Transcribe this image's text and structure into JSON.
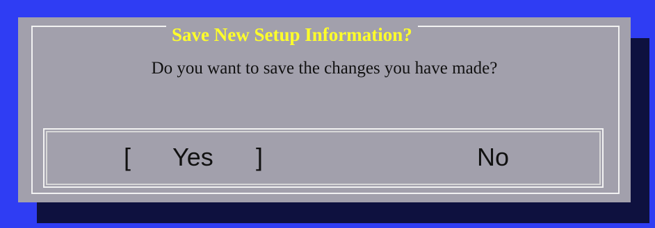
{
  "dialog": {
    "title": "Save New Setup Information?",
    "message": "Do you want to save the changes you have made?"
  },
  "buttons": {
    "yes": {
      "label": "Yes",
      "selected": true,
      "left_bracket": "[",
      "right_bracket": "]"
    },
    "no": {
      "label": "No",
      "selected": false
    }
  },
  "colors": {
    "background": "#2f3df3",
    "shadow": "#0e113f",
    "dialog": "#a2a0ac",
    "title": "#ffff2a",
    "frame": "#f2f2f2"
  }
}
